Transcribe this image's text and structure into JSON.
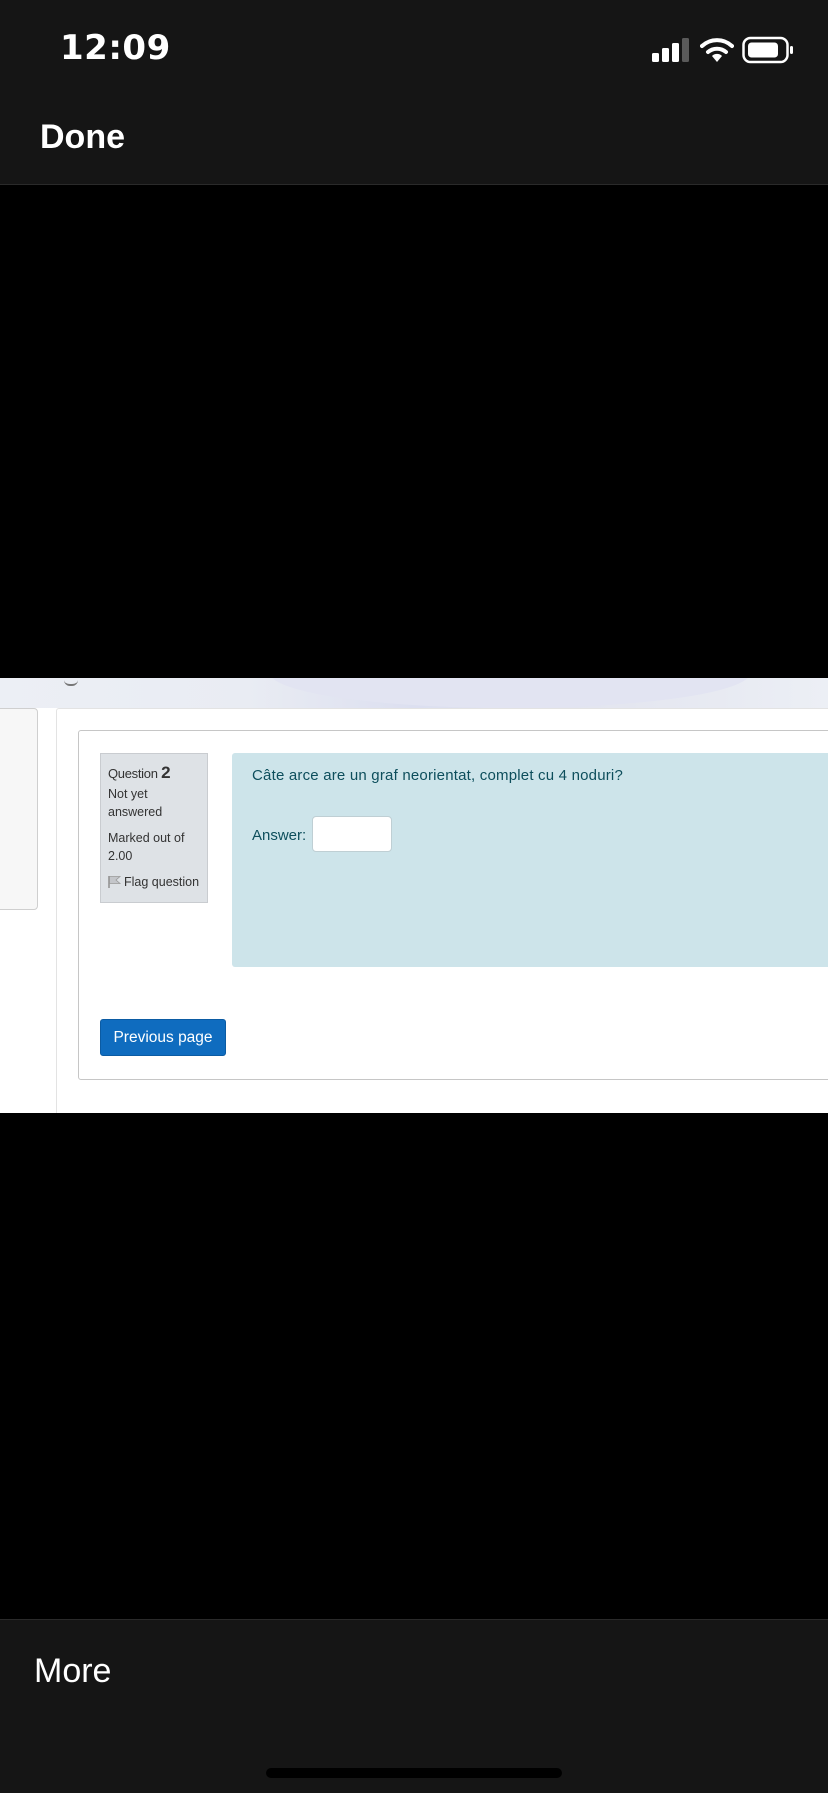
{
  "status_bar": {
    "time": "12:09",
    "signal_icon": "cellular-signal-icon",
    "wifi_icon": "wifi-icon",
    "battery_icon": "battery-icon"
  },
  "nav": {
    "done_label": "Done"
  },
  "quiz": {
    "question_label": "Question",
    "question_number": "2",
    "state": "Not yet answered",
    "grade": "Marked out of 2.00",
    "flag_icon": "flag-icon",
    "flag_label": "Flag question",
    "question_text": "Câte arce are un graf neorientat, complet cu 4 noduri?",
    "answer_label": "Answer:",
    "answer_value": "",
    "prev_button_label": "Previous page"
  },
  "toolbar": {
    "more_label": "More"
  },
  "colors": {
    "app_bar": "#151515",
    "question_bg": "#cde4ea",
    "info_bg": "#dee2e6",
    "primary_button": "#0f6cbf",
    "question_text": "#0d4e5c"
  }
}
